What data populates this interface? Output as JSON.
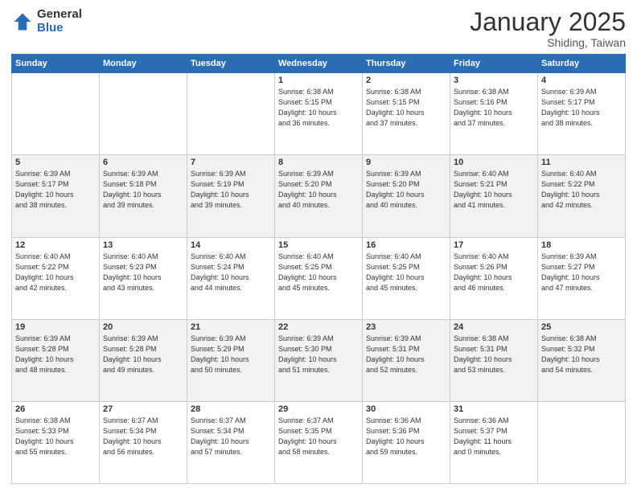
{
  "logo": {
    "general": "General",
    "blue": "Blue"
  },
  "header": {
    "month": "January 2025",
    "location": "Shiding, Taiwan"
  },
  "days_of_week": [
    "Sunday",
    "Monday",
    "Tuesday",
    "Wednesday",
    "Thursday",
    "Friday",
    "Saturday"
  ],
  "weeks": [
    [
      {
        "day": "",
        "info": ""
      },
      {
        "day": "",
        "info": ""
      },
      {
        "day": "",
        "info": ""
      },
      {
        "day": "1",
        "info": "Sunrise: 6:38 AM\nSunset: 5:15 PM\nDaylight: 10 hours\nand 36 minutes."
      },
      {
        "day": "2",
        "info": "Sunrise: 6:38 AM\nSunset: 5:15 PM\nDaylight: 10 hours\nand 37 minutes."
      },
      {
        "day": "3",
        "info": "Sunrise: 6:38 AM\nSunset: 5:16 PM\nDaylight: 10 hours\nand 37 minutes."
      },
      {
        "day": "4",
        "info": "Sunrise: 6:39 AM\nSunset: 5:17 PM\nDaylight: 10 hours\nand 38 minutes."
      }
    ],
    [
      {
        "day": "5",
        "info": "Sunrise: 6:39 AM\nSunset: 5:17 PM\nDaylight: 10 hours\nand 38 minutes."
      },
      {
        "day": "6",
        "info": "Sunrise: 6:39 AM\nSunset: 5:18 PM\nDaylight: 10 hours\nand 39 minutes."
      },
      {
        "day": "7",
        "info": "Sunrise: 6:39 AM\nSunset: 5:19 PM\nDaylight: 10 hours\nand 39 minutes."
      },
      {
        "day": "8",
        "info": "Sunrise: 6:39 AM\nSunset: 5:20 PM\nDaylight: 10 hours\nand 40 minutes."
      },
      {
        "day": "9",
        "info": "Sunrise: 6:39 AM\nSunset: 5:20 PM\nDaylight: 10 hours\nand 40 minutes."
      },
      {
        "day": "10",
        "info": "Sunrise: 6:40 AM\nSunset: 5:21 PM\nDaylight: 10 hours\nand 41 minutes."
      },
      {
        "day": "11",
        "info": "Sunrise: 6:40 AM\nSunset: 5:22 PM\nDaylight: 10 hours\nand 42 minutes."
      }
    ],
    [
      {
        "day": "12",
        "info": "Sunrise: 6:40 AM\nSunset: 5:22 PM\nDaylight: 10 hours\nand 42 minutes."
      },
      {
        "day": "13",
        "info": "Sunrise: 6:40 AM\nSunset: 5:23 PM\nDaylight: 10 hours\nand 43 minutes."
      },
      {
        "day": "14",
        "info": "Sunrise: 6:40 AM\nSunset: 5:24 PM\nDaylight: 10 hours\nand 44 minutes."
      },
      {
        "day": "15",
        "info": "Sunrise: 6:40 AM\nSunset: 5:25 PM\nDaylight: 10 hours\nand 45 minutes."
      },
      {
        "day": "16",
        "info": "Sunrise: 6:40 AM\nSunset: 5:25 PM\nDaylight: 10 hours\nand 45 minutes."
      },
      {
        "day": "17",
        "info": "Sunrise: 6:40 AM\nSunset: 5:26 PM\nDaylight: 10 hours\nand 46 minutes."
      },
      {
        "day": "18",
        "info": "Sunrise: 6:39 AM\nSunset: 5:27 PM\nDaylight: 10 hours\nand 47 minutes."
      }
    ],
    [
      {
        "day": "19",
        "info": "Sunrise: 6:39 AM\nSunset: 5:28 PM\nDaylight: 10 hours\nand 48 minutes."
      },
      {
        "day": "20",
        "info": "Sunrise: 6:39 AM\nSunset: 5:28 PM\nDaylight: 10 hours\nand 49 minutes."
      },
      {
        "day": "21",
        "info": "Sunrise: 6:39 AM\nSunset: 5:29 PM\nDaylight: 10 hours\nand 50 minutes."
      },
      {
        "day": "22",
        "info": "Sunrise: 6:39 AM\nSunset: 5:30 PM\nDaylight: 10 hours\nand 51 minutes."
      },
      {
        "day": "23",
        "info": "Sunrise: 6:39 AM\nSunset: 5:31 PM\nDaylight: 10 hours\nand 52 minutes."
      },
      {
        "day": "24",
        "info": "Sunrise: 6:38 AM\nSunset: 5:31 PM\nDaylight: 10 hours\nand 53 minutes."
      },
      {
        "day": "25",
        "info": "Sunrise: 6:38 AM\nSunset: 5:32 PM\nDaylight: 10 hours\nand 54 minutes."
      }
    ],
    [
      {
        "day": "26",
        "info": "Sunrise: 6:38 AM\nSunset: 5:33 PM\nDaylight: 10 hours\nand 55 minutes."
      },
      {
        "day": "27",
        "info": "Sunrise: 6:37 AM\nSunset: 5:34 PM\nDaylight: 10 hours\nand 56 minutes."
      },
      {
        "day": "28",
        "info": "Sunrise: 6:37 AM\nSunset: 5:34 PM\nDaylight: 10 hours\nand 57 minutes."
      },
      {
        "day": "29",
        "info": "Sunrise: 6:37 AM\nSunset: 5:35 PM\nDaylight: 10 hours\nand 58 minutes."
      },
      {
        "day": "30",
        "info": "Sunrise: 6:36 AM\nSunset: 5:36 PM\nDaylight: 10 hours\nand 59 minutes."
      },
      {
        "day": "31",
        "info": "Sunrise: 6:36 AM\nSunset: 5:37 PM\nDaylight: 11 hours\nand 0 minutes."
      },
      {
        "day": "",
        "info": ""
      }
    ]
  ]
}
